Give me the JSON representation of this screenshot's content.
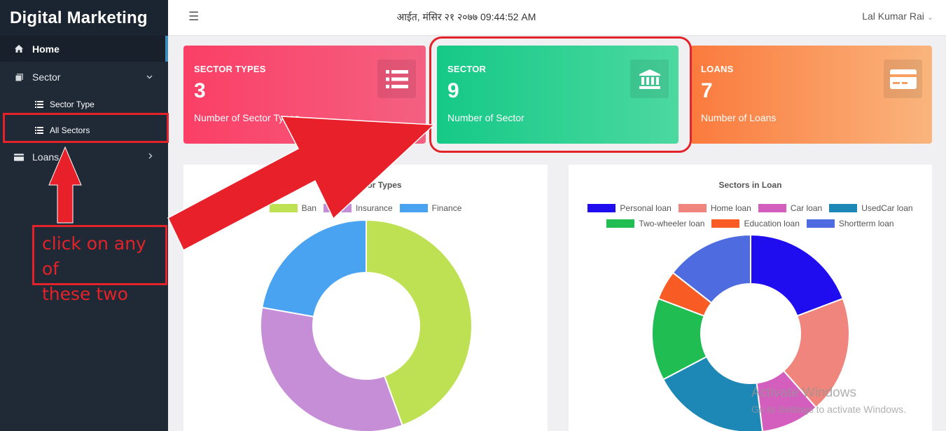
{
  "app": {
    "brand": "Digital Marketing"
  },
  "sidebar": {
    "items": [
      {
        "label": "Home",
        "icon": "home-icon"
      },
      {
        "label": "Sector",
        "icon": "copy-icon",
        "chevron": "chevron-down-icon"
      },
      {
        "label": "Sector Type",
        "icon": "list-icon"
      },
      {
        "label": "All Sectors",
        "icon": "list-icon"
      },
      {
        "label": "Loans",
        "icon": "card-icon",
        "chevron": "chevron-right-icon"
      }
    ]
  },
  "header": {
    "menu_icon": "☰",
    "datetime": "आईत, मंसिर २१ २०७७ 09:44:52 AM",
    "user": "Lal Kumar Rai",
    "user_chevron": "⌄"
  },
  "cards": [
    {
      "title": "SECTOR TYPES",
      "value": "3",
      "desc": "Number of Sector Types",
      "icon": "list-icon",
      "color": "#fb3f66"
    },
    {
      "title": "SECTOR",
      "value": "9",
      "desc": "Number of Sector",
      "icon": "bank-icon",
      "color": "#15c986"
    },
    {
      "title": "LOANS",
      "value": "7",
      "desc": "Number of Loans",
      "icon": "credit-card-icon",
      "color": "#fb7a3d"
    }
  ],
  "chart_data": [
    {
      "type": "doughnut",
      "title": "Sectors in Sector Types",
      "title_visible": "rs in Sector Types",
      "legend": [
        "Bank",
        "Insurance",
        "Finance"
      ],
      "legend_visible": [
        "Ban",
        "Insurance",
        "Finance"
      ],
      "values": [
        4,
        3,
        2
      ],
      "colors": [
        "#bde153",
        "#c78ed8",
        "#4aa3f0"
      ]
    },
    {
      "type": "doughnut",
      "title": "Sectors in Loan",
      "legend": [
        "Personal loan",
        "Home loan",
        "Car loan",
        "UsedCar loan",
        "Two-wheeler loan",
        "Education loan",
        "Shortterm loan"
      ],
      "values": [
        2,
        2,
        1,
        2,
        1.4,
        0.5,
        1.5
      ],
      "colors": [
        "#1f0df0",
        "#ef857d",
        "#d45ebd",
        "#1d88b6",
        "#1fbd52",
        "#f95b25",
        "#4f6be0"
      ]
    }
  ],
  "annotation": {
    "text_line1": "click on any of",
    "text_line2": "these two",
    "color": "#e32229"
  },
  "watermark": {
    "line1": "Activate Windows",
    "line2": "Go to Settings to activate Windows."
  }
}
